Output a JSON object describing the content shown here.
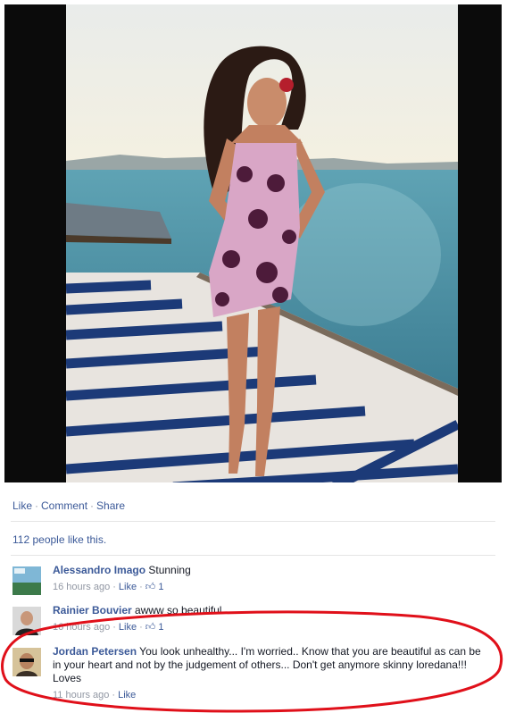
{
  "post": {
    "actions": {
      "like": "Like",
      "comment": "Comment",
      "share": "Share",
      "separator": "·"
    },
    "likes_text": "112 people like this."
  },
  "comments": [
    {
      "author": "Alessandro Imago",
      "text": "Stunning",
      "time": "16 hours ago",
      "like": "Like",
      "like_count": "1"
    },
    {
      "author": "Rainier Bouvier",
      "text": "awww so beautiful",
      "time": "16 hours ago",
      "like": "Like",
      "like_count": "1"
    },
    {
      "author": "Jordan Petersen",
      "text": "You look unhealthy... I'm worried.. Know that you are beautiful as can be in your heart and not by the judgement of others... Don't get anymore skinny loredana!!! Loves",
      "time": "11 hours ago",
      "like": "Like",
      "like_count": ""
    }
  ],
  "icons": {
    "thumbs_up": "thumbs-up-icon"
  },
  "colors": {
    "link": "#3b5998",
    "meta": "#9197a3",
    "annotation": "#e0101a"
  }
}
